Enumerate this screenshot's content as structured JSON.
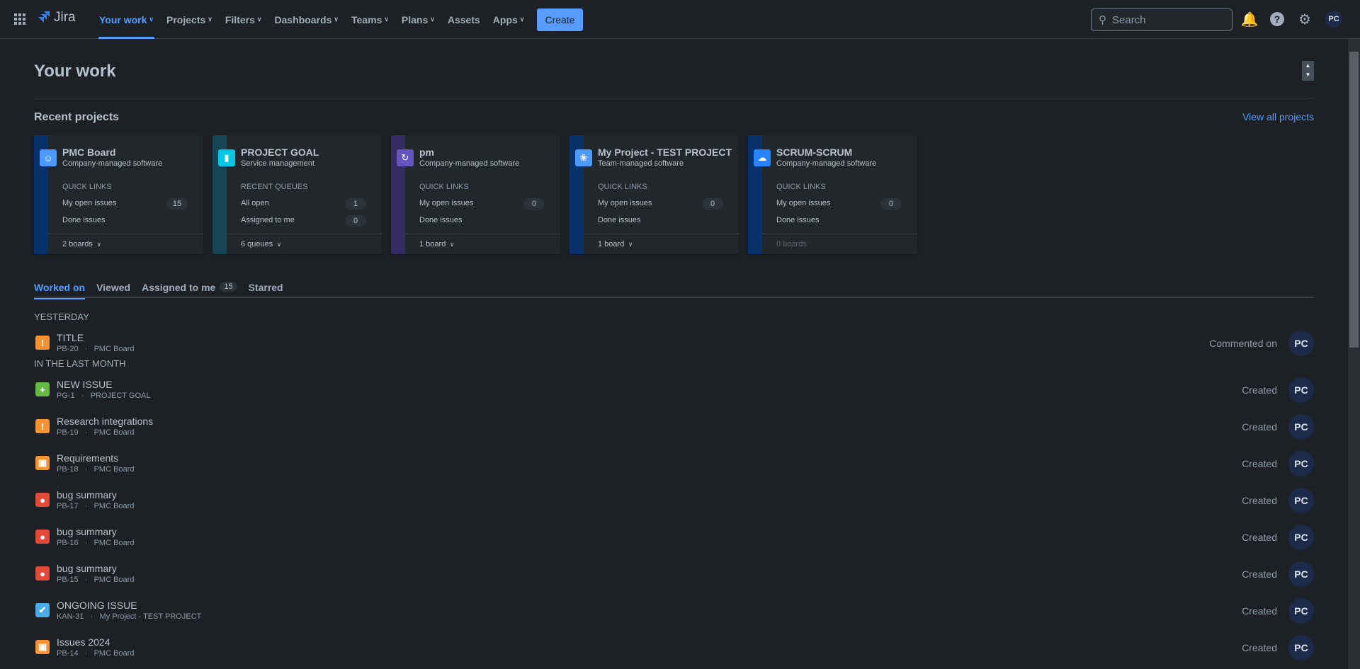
{
  "nav": {
    "logo": "Jira",
    "items": [
      {
        "label": "Your work",
        "chev": true,
        "active": true
      },
      {
        "label": "Projects",
        "chev": true
      },
      {
        "label": "Filters",
        "chev": true
      },
      {
        "label": "Dashboards",
        "chev": true
      },
      {
        "label": "Teams",
        "chev": true
      },
      {
        "label": "Plans",
        "chev": true
      },
      {
        "label": "Assets",
        "chev": false
      },
      {
        "label": "Apps",
        "chev": true
      }
    ],
    "create": "Create",
    "search_placeholder": "Search",
    "avatar": "PC"
  },
  "page": {
    "title": "Your work",
    "recent_projects": "Recent projects",
    "view_all": "View all projects"
  },
  "projects": [
    {
      "name": "PMC Board",
      "type": "Company-managed software",
      "section": "QUICK LINKS",
      "links": [
        {
          "label": "My open issues",
          "count": "15"
        },
        {
          "label": "Done issues"
        }
      ],
      "footer": "2 boards",
      "stripe": "#09326c",
      "icon_bg": "#4c9aff"
    },
    {
      "name": "PROJECT GOAL",
      "type": "Service management",
      "section": "RECENT QUEUES",
      "links": [
        {
          "label": "All open",
          "count": "1"
        },
        {
          "label": "Assigned to me",
          "count": "0"
        }
      ],
      "footer": "6 queues",
      "stripe": "#164555",
      "icon_bg": "#00c7e6"
    },
    {
      "name": "pm",
      "type": "Company-managed software",
      "section": "QUICK LINKS",
      "links": [
        {
          "label": "My open issues",
          "count": "0"
        },
        {
          "label": "Done issues"
        }
      ],
      "footer": "1 board",
      "stripe": "#352c63",
      "icon_bg": "#6554c0"
    },
    {
      "name": "My Project - TEST PROJECT",
      "type": "Team-managed software",
      "section": "QUICK LINKS",
      "links": [
        {
          "label": "My open issues",
          "count": "0"
        },
        {
          "label": "Done issues"
        }
      ],
      "footer": "1 board",
      "stripe": "#09326c",
      "icon_bg": "#4c9aff"
    },
    {
      "name": "SCRUM-SCRUM",
      "type": "Company-managed software",
      "section": "QUICK LINKS",
      "links": [
        {
          "label": "My open issues",
          "count": "0"
        },
        {
          "label": "Done issues"
        }
      ],
      "footer": "0 boards",
      "footer_disabled": true,
      "stripe": "#09326c",
      "icon_bg": "#2684ff"
    }
  ],
  "tabs": [
    {
      "label": "Worked on",
      "active": true
    },
    {
      "label": "Viewed"
    },
    {
      "label": "Assigned to me",
      "badge": "15"
    },
    {
      "label": "Starred"
    }
  ],
  "groups": [
    {
      "label": "YESTERDAY",
      "items": [
        {
          "title": "TITLE",
          "key": "PB-20",
          "project": "PMC Board",
          "action": "Commented on",
          "icon": "improvement",
          "avatar": "PC"
        }
      ]
    },
    {
      "label": "IN THE LAST MONTH",
      "items": [
        {
          "title": "NEW ISSUE",
          "key": "PG-1",
          "project": "PROJECT GOAL",
          "action": "Created",
          "icon": "new-feature",
          "avatar": "PC"
        },
        {
          "title": "Research integrations",
          "key": "PB-19",
          "project": "PMC Board",
          "action": "Created",
          "icon": "improvement",
          "avatar": "PC"
        },
        {
          "title": "Requirements",
          "key": "PB-18",
          "project": "PMC Board",
          "action": "Created",
          "icon": "lock",
          "avatar": "PC"
        },
        {
          "title": "bug summary",
          "key": "PB-17",
          "project": "PMC Board",
          "action": "Created",
          "icon": "bug",
          "avatar": "PC"
        },
        {
          "title": "bug summary",
          "key": "PB-16",
          "project": "PMC Board",
          "action": "Created",
          "icon": "bug",
          "avatar": "PC"
        },
        {
          "title": "bug summary",
          "key": "PB-15",
          "project": "PMC Board",
          "action": "Created",
          "icon": "bug",
          "avatar": "PC"
        },
        {
          "title": "ONGOING ISSUE",
          "key": "KAN-31",
          "project": "My Project - TEST PROJECT",
          "action": "Created",
          "icon": "task",
          "avatar": "PC"
        },
        {
          "title": "Issues 2024",
          "key": "PB-14",
          "project": "PMC Board",
          "action": "Created",
          "icon": "lock",
          "avatar": "PC"
        }
      ]
    }
  ]
}
